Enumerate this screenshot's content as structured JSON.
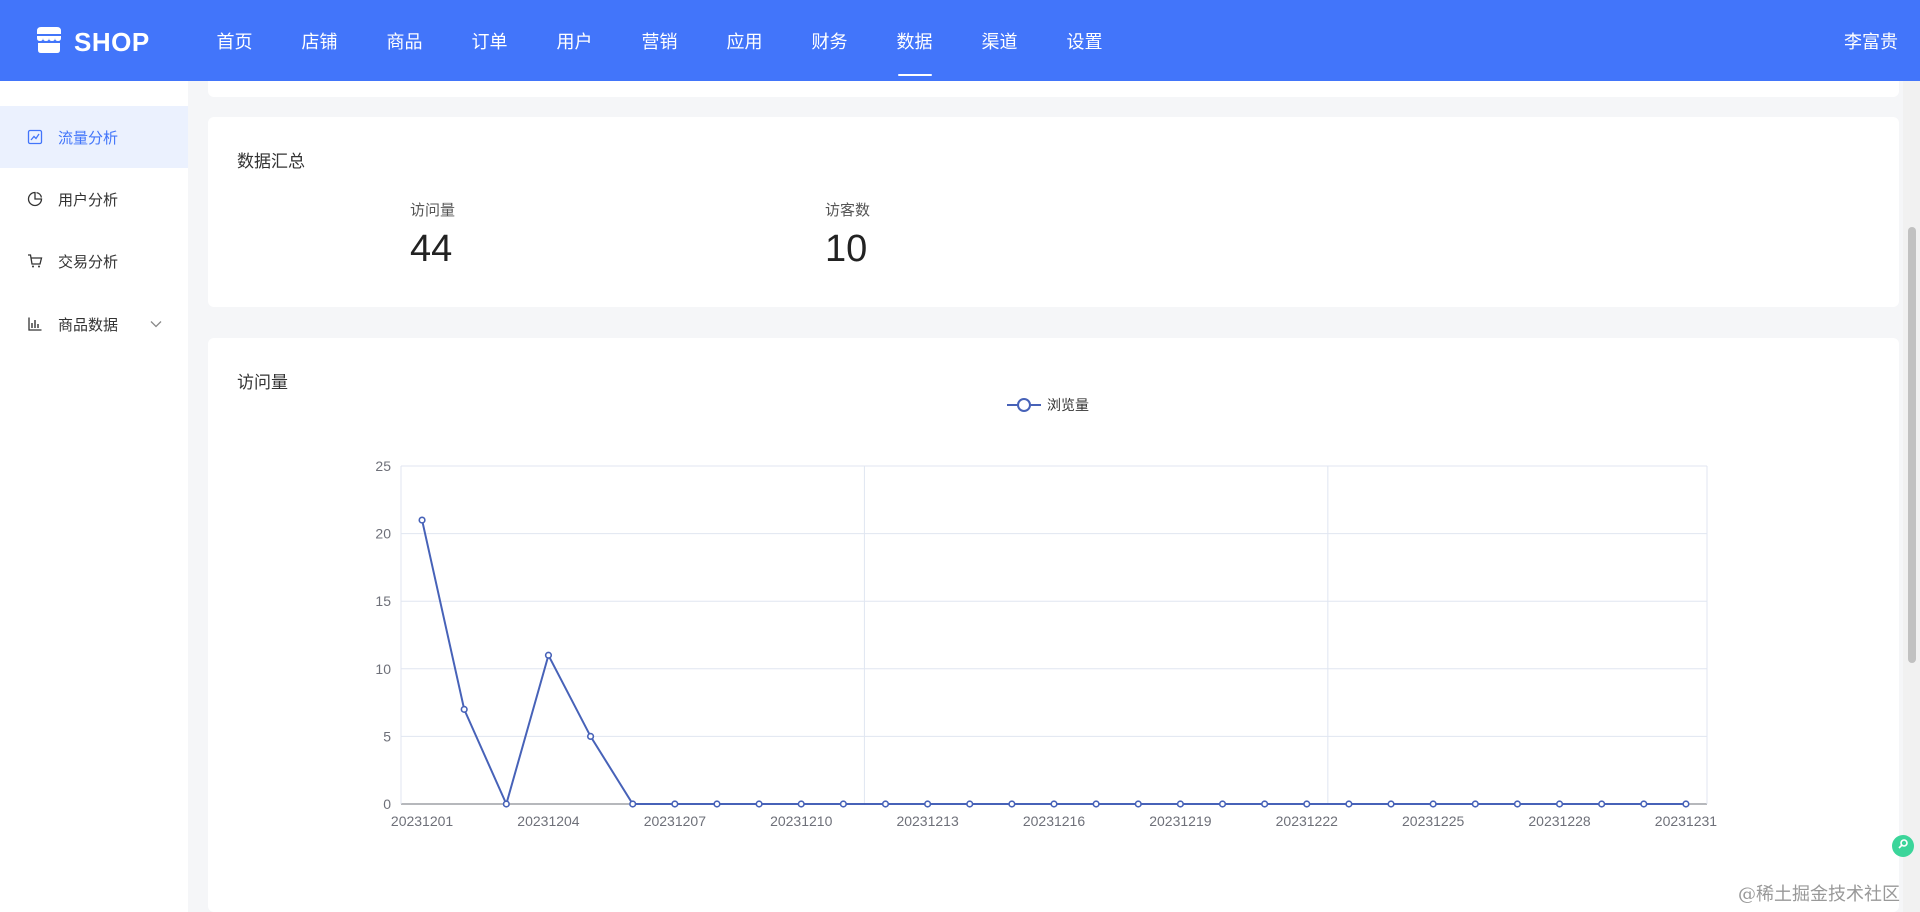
{
  "header": {
    "logo_text": "SHOP",
    "nav": [
      {
        "label": "首页",
        "active": false
      },
      {
        "label": "店铺",
        "active": false
      },
      {
        "label": "商品",
        "active": false
      },
      {
        "label": "订单",
        "active": false
      },
      {
        "label": "用户",
        "active": false
      },
      {
        "label": "营销",
        "active": false
      },
      {
        "label": "应用",
        "active": false
      },
      {
        "label": "财务",
        "active": false
      },
      {
        "label": "数据",
        "active": true
      },
      {
        "label": "渠道",
        "active": false
      },
      {
        "label": "设置",
        "active": false
      }
    ],
    "user_name": "李富贵"
  },
  "sidebar": {
    "items": [
      {
        "label": "流量分析",
        "icon": "line-chart-icon",
        "active": true
      },
      {
        "label": "用户分析",
        "icon": "pie-chart-icon",
        "active": false
      },
      {
        "label": "交易分析",
        "icon": "cart-icon",
        "active": false
      },
      {
        "label": "商品数据",
        "icon": "bar-chart-icon",
        "active": false,
        "expandable": true
      }
    ]
  },
  "summary": {
    "title": "数据汇总",
    "stats": [
      {
        "label": "访问量",
        "value": "44"
      },
      {
        "label": "访客数",
        "value": "10"
      }
    ]
  },
  "chart_section": {
    "title": "访问量"
  },
  "chart_data": {
    "type": "line",
    "title": "",
    "xlabel": "",
    "ylabel": "",
    "ylim": [
      0,
      25
    ],
    "yticks": [
      0,
      5,
      10,
      15,
      20,
      25
    ],
    "x": [
      "20231201",
      "20231202",
      "20231203",
      "20231204",
      "20231205",
      "20231206",
      "20231207",
      "20231208",
      "20231209",
      "20231210",
      "20231211",
      "20231212",
      "20231213",
      "20231214",
      "20231215",
      "20231216",
      "20231217",
      "20231218",
      "20231219",
      "20231220",
      "20231221",
      "20231222",
      "20231223",
      "20231224",
      "20231225",
      "20231226",
      "20231227",
      "20231228",
      "20231229",
      "20231230",
      "20231231"
    ],
    "xtick_labels": [
      "20231201",
      "20231204",
      "20231207",
      "20231210",
      "20231213",
      "20231216",
      "20231219",
      "20231222",
      "20231225",
      "20231228",
      "20231231"
    ],
    "series": [
      {
        "name": "浏览量",
        "color": "#4762b8",
        "values": [
          21,
          7,
          0,
          11,
          5,
          0,
          0,
          0,
          0,
          0,
          0,
          0,
          0,
          0,
          0,
          0,
          0,
          0,
          0,
          0,
          0,
          0,
          0,
          0,
          0,
          0,
          0,
          0,
          0,
          0,
          0
        ]
      }
    ],
    "legend": "top-center",
    "grid": true
  },
  "watermark": "@稀土掘金技术社区",
  "colors": {
    "brand": "#4275fa",
    "active_bg": "#ebf1fe",
    "series": "#4762b8"
  }
}
